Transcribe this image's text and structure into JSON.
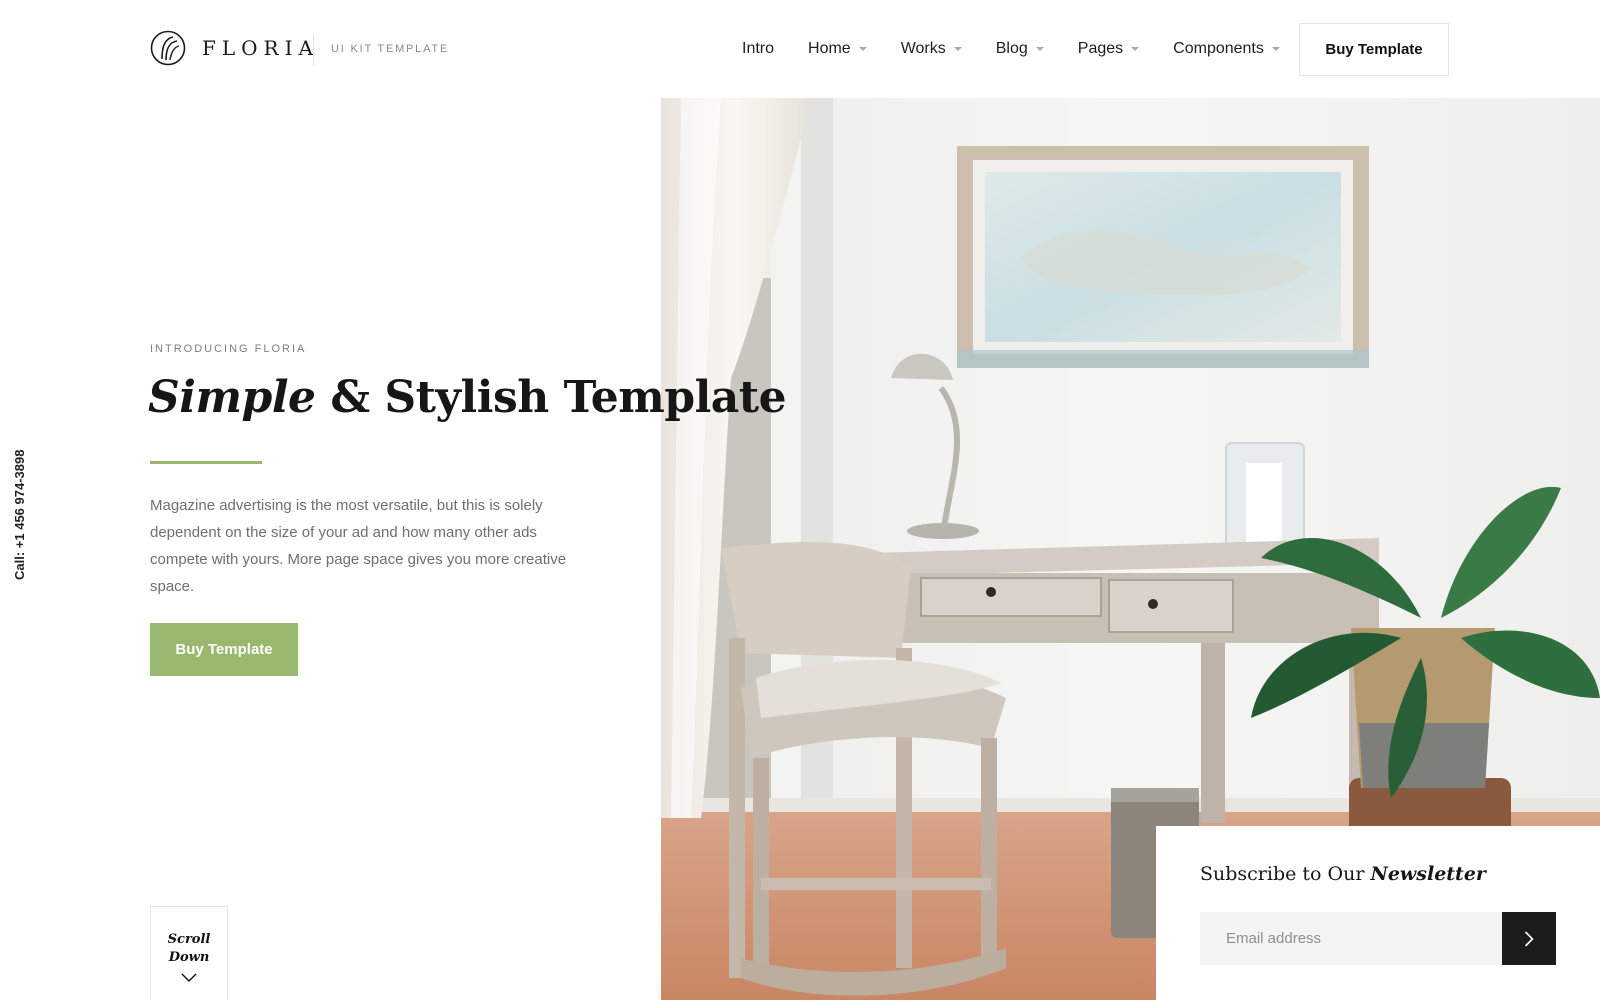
{
  "brand": {
    "name": "FLORIA",
    "tagline": "UI KIT TEMPLATE",
    "logo_icon": "floria-logo-mark"
  },
  "nav": {
    "items": [
      {
        "label": "Intro",
        "has_dropdown": false
      },
      {
        "label": "Home",
        "has_dropdown": true
      },
      {
        "label": "Works",
        "has_dropdown": true
      },
      {
        "label": "Blog",
        "has_dropdown": true
      },
      {
        "label": "Pages",
        "has_dropdown": true
      },
      {
        "label": "Components",
        "has_dropdown": true
      }
    ],
    "cta_label": "Buy Template"
  },
  "side": {
    "call_text": "Call: +1 456 974-3898"
  },
  "hero": {
    "eyebrow": "INTRODUCING FLORIA",
    "title_emphasis": "Simple",
    "title_rest": " & Stylish Template",
    "description": "Magazine advertising is the most versatile, but this is solely dependent on the size of your ad and how many other ads compete with yours. More page space gives you more creative space.",
    "button_label": "Buy Template",
    "scroll_label": "Scroll Down",
    "scroll_icon": "chevron-down-icon"
  },
  "newsletter": {
    "title_prefix": "Subscribe to Our ",
    "title_emphasis": "Newsletter",
    "email_placeholder": "Email address",
    "submit_icon": "chevron-right-icon"
  },
  "colors": {
    "accent_green": "#99b86d",
    "dark": "#1b1b1b",
    "muted_text": "#6f6f6f"
  }
}
